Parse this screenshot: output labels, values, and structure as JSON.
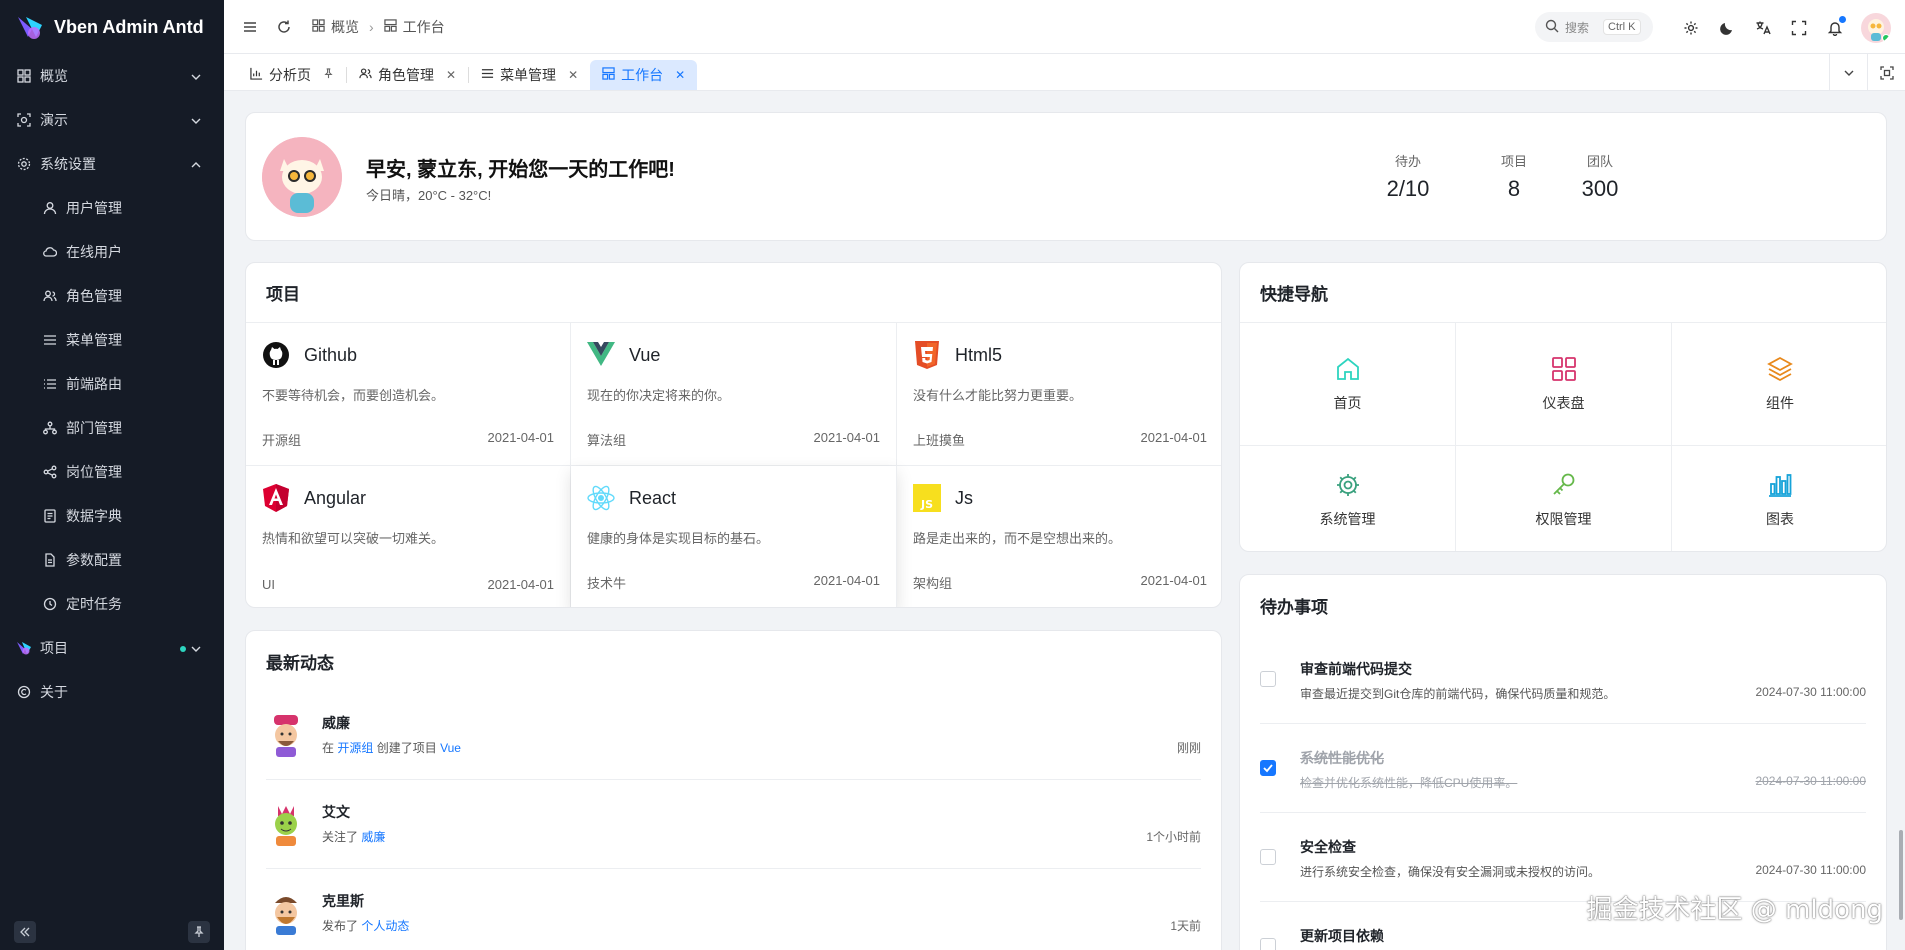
{
  "app": {
    "title": "Vben Admin Antd"
  },
  "sidebar": {
    "items": [
      {
        "label": "概览"
      },
      {
        "label": "演示"
      },
      {
        "label": "系统设置"
      },
      {
        "label": "用户管理"
      },
      {
        "label": "在线用户"
      },
      {
        "label": "角色管理"
      },
      {
        "label": "菜单管理"
      },
      {
        "label": "前端路由"
      },
      {
        "label": "部门管理"
      },
      {
        "label": "岗位管理"
      },
      {
        "label": "数据字典"
      },
      {
        "label": "参数配置"
      },
      {
        "label": "定时任务"
      },
      {
        "label": "项目"
      },
      {
        "label": "关于"
      }
    ]
  },
  "header": {
    "breadcrumb": [
      "概览",
      "工作台"
    ],
    "search_placeholder": "搜索",
    "search_shortcut": "Ctrl K"
  },
  "tabs": [
    {
      "label": "分析页"
    },
    {
      "label": "角色管理"
    },
    {
      "label": "菜单管理"
    },
    {
      "label": "工作台"
    }
  ],
  "welcome": {
    "greeting": "早安, 蒙立东, 开始您一天的工作吧!",
    "weather": "今日晴，20°C - 32°C!",
    "stats": [
      {
        "label": "待办",
        "value": "2/10"
      },
      {
        "label": "项目",
        "value": "8"
      },
      {
        "label": "团队",
        "value": "300"
      }
    ]
  },
  "projects": {
    "title": "项目",
    "items": [
      {
        "name": "Github",
        "desc": "不要等待机会，而要创造机会。",
        "group": "开源组",
        "date": "2021-04-01"
      },
      {
        "name": "Vue",
        "desc": "现在的你决定将来的你。",
        "group": "算法组",
        "date": "2021-04-01"
      },
      {
        "name": "Html5",
        "desc": "没有什么才能比努力更重要。",
        "group": "上班摸鱼",
        "date": "2021-04-01"
      },
      {
        "name": "Angular",
        "desc": "热情和欲望可以突破一切难关。",
        "group": "UI",
        "date": "2021-04-01"
      },
      {
        "name": "React",
        "desc": "健康的身体是实现目标的基石。",
        "group": "技术牛",
        "date": "2021-04-01"
      },
      {
        "name": "Js",
        "desc": "路是走出来的，而不是空想出来的。",
        "group": "架构组",
        "date": "2021-04-01"
      }
    ]
  },
  "quick_nav": {
    "title": "快捷导航",
    "items": [
      {
        "label": "首页",
        "color": "#2dd4bf"
      },
      {
        "label": "仪表盘",
        "color": "#d6336c"
      },
      {
        "label": "组件",
        "color": "#e8891c"
      },
      {
        "label": "系统管理",
        "color": "#3aa17e"
      },
      {
        "label": "权限管理",
        "color": "#65b84a"
      },
      {
        "label": "图表",
        "color": "#16a3d9"
      }
    ]
  },
  "activity": {
    "title": "最新动态",
    "items": [
      {
        "name": "威廉",
        "pre": "在",
        "link1": "开源组",
        "mid": "创建了项目",
        "link2": "Vue",
        "time": "刚刚"
      },
      {
        "name": "艾文",
        "pre": "关注了",
        "link1": "威廉",
        "mid": "",
        "link2": "",
        "time": "1个小时前"
      },
      {
        "name": "克里斯",
        "pre": "发布了",
        "link1": "个人动态",
        "mid": "",
        "link2": "",
        "time": "1天前"
      }
    ]
  },
  "todo": {
    "title": "待办事项",
    "items": [
      {
        "title": "审查前端代码提交",
        "desc": "审查最近提交到Git仓库的前端代码，确保代码质量和规范。",
        "date": "2024-07-30 11:00:00",
        "done": false
      },
      {
        "title": "系统性能优化",
        "desc": "检查并优化系统性能，降低CPU使用率。",
        "date": "2024-07-30 11:00:00",
        "done": true
      },
      {
        "title": "安全检查",
        "desc": "进行系统安全检查，确保没有安全漏洞或未授权的访问。",
        "date": "2024-07-30 11:00:00",
        "done": false
      },
      {
        "title": "更新项目依赖",
        "desc": "",
        "date": "",
        "done": false
      }
    ]
  },
  "watermark": "掘金技术社区 @ mldong",
  "colors": {
    "accent": "#1677ff",
    "sidebar_bg": "#151b26"
  }
}
